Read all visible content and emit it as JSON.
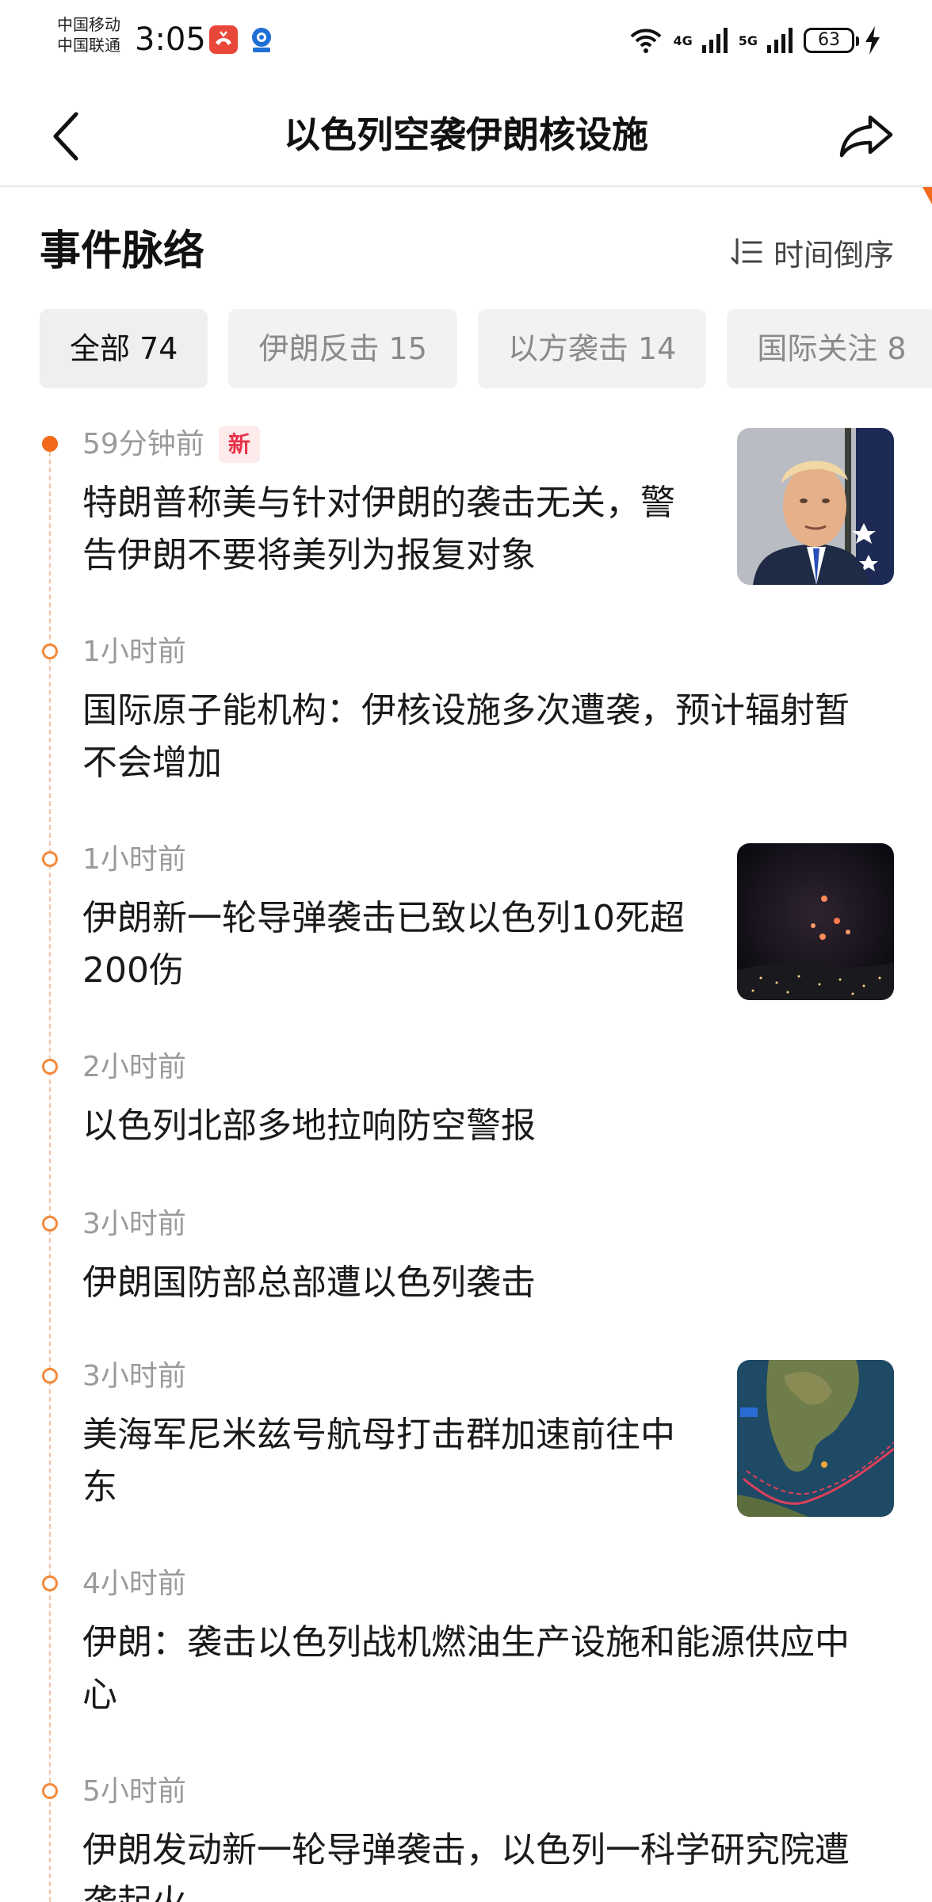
{
  "status_bar": {
    "carrier_1": "中国移动",
    "carrier_2": "中国联通",
    "time": "3:05",
    "battery": "63",
    "network_1": "4G",
    "network_2": "5G"
  },
  "header": {
    "title": "以色列空袭伊朗核设施",
    "back_icon": "chevron-left-icon",
    "share_icon": "share-arrow-icon"
  },
  "section": {
    "title": "事件脉络",
    "sort_label": "时间倒序",
    "sort_icon": "sort-descending-icon"
  },
  "tabs": [
    {
      "label": "全部 74",
      "active": true
    },
    {
      "label": "伊朗反击 15",
      "active": false
    },
    {
      "label": "以方袭击 14",
      "active": false
    },
    {
      "label": "国际关注 8",
      "active": false
    }
  ],
  "events": [
    {
      "time": "59分钟前",
      "badge": "新",
      "headline": "特朗普称美与针对伊朗的袭击无关，警告伊朗不要将美列为报复对象",
      "thumbnail": "portrait-photo"
    },
    {
      "time": "1小时前",
      "headline": "国际原子能机构：伊核设施多次遭袭，预计辐射暂不会增加"
    },
    {
      "time": "1小时前",
      "headline": "伊朗新一轮导弹袭击已致以色列10死超200伤",
      "thumbnail": "night-missile-photo"
    },
    {
      "time": "2小时前",
      "headline": "以色列北部多地拉响防空警报"
    },
    {
      "time": "3小时前",
      "headline": "伊朗国防部总部遭以色列袭击"
    },
    {
      "time": "3小时前",
      "headline": "美海军尼米兹号航母打击群加速前往中东",
      "thumbnail": "route-map-image"
    },
    {
      "time": "4小时前",
      "headline": "伊朗：袭击以色列战机燃油生产设施和能源供应中心"
    },
    {
      "time": "5小时前",
      "headline": "伊朗发动新一轮导弹袭击，以色列一科学研究院遭袭起火"
    }
  ],
  "colors": {
    "accent": "#f26a1b",
    "timeline_line": "#f4c6a6",
    "badge_text": "#e8334a",
    "badge_bg": "#fdeaea",
    "tab_bg": "#f2f2f2"
  }
}
